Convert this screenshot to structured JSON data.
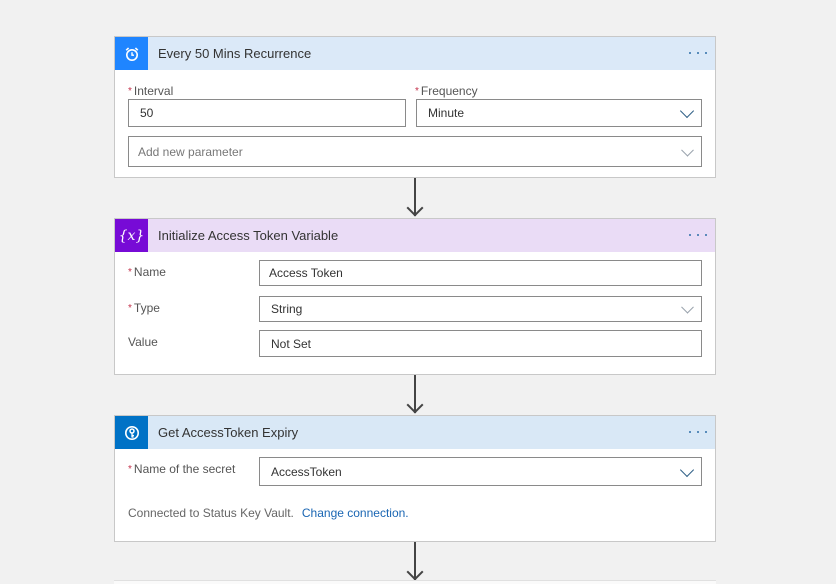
{
  "colors": {
    "canvas_bg": "#f1f1f1",
    "recurrence_accent": "#1f85ff",
    "recurrence_header_bg": "#dbe9f8",
    "variable_accent": "#770bd6",
    "variable_header_bg": "#eadcf6",
    "keyvault_accent": "#0072c6",
    "keyvault_header_bg": "#d9e8f6",
    "required_marker": "#c4314b",
    "link": "#1a66b3"
  },
  "cards": {
    "recurrence": {
      "icon": "alarm-clock-icon",
      "title": "Every 50 Mins Recurrence",
      "more_label": "More options",
      "interval": {
        "label": "Interval",
        "required": "*",
        "value": "50"
      },
      "frequency": {
        "label": "Frequency",
        "required": "*",
        "value": "Minute"
      },
      "add_parameter": {
        "placeholder": "Add new parameter"
      }
    },
    "init_variable": {
      "icon": "variable-icon",
      "icon_text": "{x}",
      "title": "Initialize Access Token Variable",
      "more_label": "More options",
      "name": {
        "label": "Name",
        "required": "*",
        "value": "Access Token"
      },
      "type": {
        "label": "Type",
        "required": "*",
        "value": "String"
      },
      "value": {
        "label": "Value",
        "value": "Not Set"
      }
    },
    "get_secret": {
      "icon": "key-vault-icon",
      "title": "Get AccessToken Expiry",
      "more_label": "More options",
      "secret_name": {
        "label": "Name of the secret",
        "required": "*",
        "value": "AccessToken"
      },
      "connection_text": "Connected to Status Key Vault.",
      "change_connection": "Change connection."
    }
  }
}
